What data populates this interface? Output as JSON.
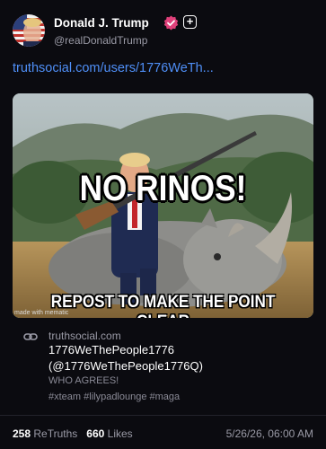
{
  "post": {
    "author_name": "Donald J. Trump",
    "author_handle": "@realDonaldTrump",
    "link_text": "truthsocial.com/users/1776WeTh...",
    "image": {
      "caption_top": "NO RINOS!",
      "caption_bottom": "REPOST TO MAKE THE POINT CLEAR",
      "watermark": "made with mematic"
    },
    "card": {
      "domain": "truthsocial.com",
      "title_line1": "1776WeThePeople1776",
      "title_line2": "(@1776WeThePeople1776Q)",
      "desc_line1": "WHO AGREES!",
      "desc_line2": "#xteam #lilypadlounge #maga"
    },
    "stats": {
      "retruths_count": "258",
      "retruths_label": "ReTruths",
      "likes_count": "660",
      "likes_label": "Likes"
    },
    "timestamp": "5/26/26, 06:00 AM"
  },
  "colors": {
    "background": "#0b0b10",
    "link": "#4f8ff7",
    "verified_badge": "#e0407a",
    "muted_text": "#9a9aa6"
  },
  "icons": [
    "avatar-image",
    "verified-badge-icon",
    "plus-icon",
    "link-chain-icon"
  ]
}
